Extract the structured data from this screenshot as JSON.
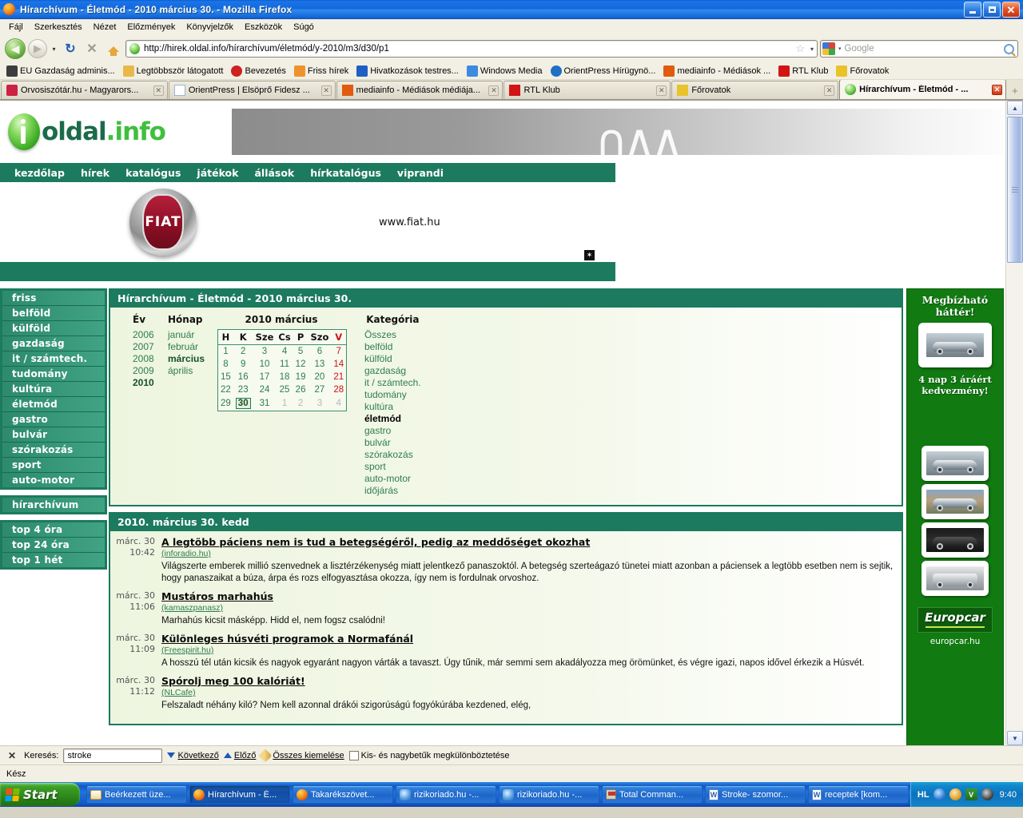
{
  "window": {
    "title": "Hírarchívum - Életmód - 2010 március 30. - Mozilla Firefox",
    "minimize_label": "_",
    "maximize_label": "❐",
    "close_label": "✕"
  },
  "menubar": [
    {
      "label": "Fájl"
    },
    {
      "label": "Szerkesztés"
    },
    {
      "label": "Nézet"
    },
    {
      "label": "Előzmények"
    },
    {
      "label": "Könyvjelzők"
    },
    {
      "label": "Eszközök"
    },
    {
      "label": "Súgó"
    }
  ],
  "toolbar": {
    "back_glyph": "◀",
    "forward_glyph": "▶",
    "dropdown_glyph": "▾",
    "reload_glyph": "↻",
    "stop_glyph": "✕",
    "home_label": "home-icon",
    "url": "http://hirek.oldal.info/hírarchívum/életmód/y-2010/m3/d30/p1",
    "star_glyph": "☆",
    "url_caret": "▾",
    "search_placeholder": "Google",
    "search_caret": "▾"
  },
  "bookmarks": [
    {
      "label": "EU Gazdaság adminis...",
      "color": "#3d3d3d"
    },
    {
      "label": "Legtöbbször látogatott",
      "color": "#e8b94a"
    },
    {
      "label": "Bevezetés",
      "color": "#cc2222"
    },
    {
      "label": "Friss hírek",
      "color": "#f0922a"
    },
    {
      "label": "Hivatkozások testres...",
      "color": "#1e5fc4"
    },
    {
      "label": "Windows Media",
      "color": "#3d8ae0"
    },
    {
      "label": "OrientPress Hírügynö...",
      "color": "#1f6fc4"
    },
    {
      "label": "mediainfo - Médiások ...",
      "color": "#e05a10"
    },
    {
      "label": "RTL Klub",
      "color": "#d21414"
    },
    {
      "label": "Főrovatok",
      "color": "#e8c32a"
    }
  ],
  "tabs": [
    {
      "label": "Orvosiszótár.hu - Magyarors...",
      "active": false,
      "close": "✕",
      "color": "#cc2244"
    },
    {
      "label": "OrientPress | Elsöprő Fidesz ...",
      "active": false,
      "close": "✕",
      "color": "#ffffff"
    },
    {
      "label": "mediainfo - Médiások médiája...",
      "active": false,
      "close": "✕",
      "color": "#e05a10"
    },
    {
      "label": "RTL Klub",
      "active": false,
      "close": "✕",
      "color": "#d21414"
    },
    {
      "label": "Főrovatok",
      "active": false,
      "close": "✕",
      "color": "#e8c32a"
    },
    {
      "label": "Hírarchívum - Életmód - ...",
      "active": true,
      "close": "✕",
      "color": "#3fae27"
    }
  ],
  "tab_new_glyph": "+",
  "site": {
    "logo_text_a": "oldal",
    "logo_text_b": ".info",
    "nav": [
      {
        "label": "kezdőlap"
      },
      {
        "label": "hírek"
      },
      {
        "label": "katalógus"
      },
      {
        "label": "játékok"
      },
      {
        "label": "állások"
      },
      {
        "label": "hírkatalógus"
      },
      {
        "label": "viprandi"
      }
    ],
    "ad_banner": {
      "brand": "FIAT",
      "url": "www.fiat.hu",
      "close_glyph": "✶"
    }
  },
  "sidebar": {
    "group1": [
      {
        "label": "friss"
      },
      {
        "label": "belföld"
      },
      {
        "label": "külföld"
      },
      {
        "label": "gazdaság"
      },
      {
        "label": "it / számtech."
      },
      {
        "label": "tudomány"
      },
      {
        "label": "kultúra"
      },
      {
        "label": "életmód"
      },
      {
        "label": "gastro"
      },
      {
        "label": "bulvár"
      },
      {
        "label": "szórakozás"
      },
      {
        "label": "sport"
      },
      {
        "label": "auto-motor"
      }
    ],
    "group2": [
      {
        "label": "hírarchívum"
      }
    ],
    "group3": [
      {
        "label": "top 4 óra"
      },
      {
        "label": "top 24 óra"
      },
      {
        "label": "top 1 hét"
      }
    ]
  },
  "archive": {
    "panel_title": "Hírarchívum - Életmód - 2010 március 30.",
    "col_year_header": "Év",
    "col_month_header": "Hónap",
    "col_cal_header": "2010 március",
    "col_cat_header": "Kategória",
    "years": [
      {
        "label": "2006",
        "selected": false
      },
      {
        "label": "2007",
        "selected": false
      },
      {
        "label": "2008",
        "selected": false
      },
      {
        "label": "2009",
        "selected": false
      },
      {
        "label": "2010",
        "selected": true
      }
    ],
    "months": [
      {
        "label": "január",
        "selected": false
      },
      {
        "label": "február",
        "selected": false
      },
      {
        "label": "március",
        "selected": true
      },
      {
        "label": "április",
        "selected": false
      }
    ],
    "weekday_headers": [
      "H",
      "K",
      "Sze",
      "Cs",
      "P",
      "Szo",
      "V"
    ],
    "weeks": [
      [
        {
          "d": "1"
        },
        {
          "d": "2"
        },
        {
          "d": "3"
        },
        {
          "d": "4"
        },
        {
          "d": "5"
        },
        {
          "d": "6"
        },
        {
          "d": "7",
          "sun": true
        }
      ],
      [
        {
          "d": "8"
        },
        {
          "d": "9"
        },
        {
          "d": "10"
        },
        {
          "d": "11"
        },
        {
          "d": "12"
        },
        {
          "d": "13"
        },
        {
          "d": "14",
          "sun": true
        }
      ],
      [
        {
          "d": "15"
        },
        {
          "d": "16"
        },
        {
          "d": "17"
        },
        {
          "d": "18"
        },
        {
          "d": "19"
        },
        {
          "d": "20"
        },
        {
          "d": "21",
          "sun": true
        }
      ],
      [
        {
          "d": "22"
        },
        {
          "d": "23"
        },
        {
          "d": "24"
        },
        {
          "d": "25"
        },
        {
          "d": "26"
        },
        {
          "d": "27"
        },
        {
          "d": "28",
          "sun": true
        }
      ],
      [
        {
          "d": "29"
        },
        {
          "d": "30",
          "today": true
        },
        {
          "d": "31"
        },
        {
          "d": "1",
          "off": true
        },
        {
          "d": "2",
          "off": true
        },
        {
          "d": "3",
          "off": true
        },
        {
          "d": "4",
          "off": true
        }
      ]
    ],
    "categories": [
      {
        "label": "Összes",
        "current": false
      },
      {
        "label": "belföld",
        "current": false
      },
      {
        "label": "külföld",
        "current": false
      },
      {
        "label": "gazdaság",
        "current": false
      },
      {
        "label": "it / számtech.",
        "current": false
      },
      {
        "label": "tudomány",
        "current": false
      },
      {
        "label": "kultúra",
        "current": false
      },
      {
        "label": "életmód",
        "current": true
      },
      {
        "label": "gastro",
        "current": false
      },
      {
        "label": "bulvár",
        "current": false
      },
      {
        "label": "szórakozás",
        "current": false
      },
      {
        "label": "sport",
        "current": false
      },
      {
        "label": "auto-motor",
        "current": false
      },
      {
        "label": "időjárás",
        "current": false
      }
    ]
  },
  "news": {
    "day_header": "2010. március 30. kedd",
    "items": [
      {
        "date": "márc. 30",
        "time": "10:42",
        "title": "A legtöbb páciens nem is tud a betegségéről, pedig az meddőséget okozhat",
        "source": "(inforadio.hu)",
        "lead": "Világszerte emberek millió szenvednek a lisztérzékenység miatt jelentkező panaszoktól. A betegség szerteágazó tünetei miatt azonban a páciensek a legtöbb esetben nem is sejtik, hogy panaszaikat a búza, árpa és rozs elfogyasztása okozza, így nem is fordulnak orvoshoz."
      },
      {
        "date": "márc. 30",
        "time": "11:06",
        "title": "Mustáros marhahús",
        "source": "(kamaszpanasz)",
        "lead": "Marhahús kicsit másképp. Hidd el, nem fogsz csalódni!"
      },
      {
        "date": "márc. 30",
        "time": "11:09",
        "title": "Különleges húsvéti programok a Normafánál",
        "source": "(Freespirit.hu)",
        "lead": "A hosszú tél után kicsik és nagyok egyaránt nagyon várták a tavaszt. Úgy tűnik, már semmi sem akadályozza meg örömünket, és végre igazi, napos idővel érkezik a Húsvét."
      },
      {
        "date": "márc. 30",
        "time": "11:12",
        "title": "Spórolj meg 100 kalóriát!",
        "source": "(NLCafe)",
        "lead": "Felszaladt néhány kiló? Nem kell azonnal drákói szigorúságú fogyókúrába kezdened, elég,"
      }
    ]
  },
  "ad": {
    "headline": "Megbízható háttér!",
    "subline": "4 nap 3 áráért kedvezmény!",
    "brand": "Europcar",
    "url": "europcar.hu"
  },
  "findbar": {
    "close_glyph": "✕",
    "label": "Keresés:",
    "value": "stroke",
    "next_label": "Következő",
    "prev_label": "Előző",
    "highlight_label": "Összes kiemelése",
    "matchcase_label": "Kis- és nagybetűk megkülönböztetése"
  },
  "status": {
    "text": "Kész"
  },
  "taskbar": {
    "start_label": "Start",
    "tasks": [
      {
        "label": "Beérkezett üze...",
        "icon": "mail",
        "active": false
      },
      {
        "label": "Hírarchívum - É...",
        "icon": "firefox",
        "active": true
      },
      {
        "label": "Takarékszövet...",
        "icon": "firefox",
        "active": false
      },
      {
        "label": "rizikoriado.hu -...",
        "icon": "ie",
        "active": false
      },
      {
        "label": "rizikoriado.hu -...",
        "icon": "ie",
        "active": false
      },
      {
        "label": "Total Comman...",
        "icon": "tc",
        "active": false
      },
      {
        "label": "Stroke- szomor...",
        "icon": "word",
        "active": false
      },
      {
        "label": "receptek [kom...",
        "icon": "word",
        "active": false
      }
    ],
    "lang": "HL",
    "clock": "9:40",
    "tray_icons": [
      "back-arrow-icon",
      "mail-tray-icon",
      "v2-icon",
      "avira-icon"
    ]
  }
}
